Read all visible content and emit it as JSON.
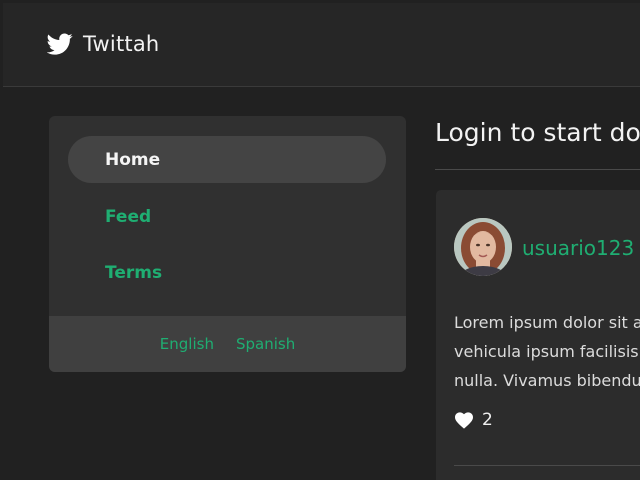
{
  "app": {
    "brand_name": "Twittah",
    "brand_icon": "twitter-bird-icon",
    "accent_color": "#1fae72"
  },
  "sidebar": {
    "items": [
      {
        "label": "Home",
        "active": true
      },
      {
        "label": "Feed",
        "active": false
      },
      {
        "label": "Terms",
        "active": false
      }
    ],
    "languages": [
      {
        "label": "English"
      },
      {
        "label": "Spanish"
      }
    ]
  },
  "main": {
    "title": "Login to start doi",
    "post": {
      "username": "usuario123",
      "text_lines": [
        "Lorem ipsum dolor sit a",
        "vehicula ipsum facilisis",
        "nulla. Vivamus bibendu"
      ],
      "likes": "2",
      "like_icon": "heart-icon"
    }
  }
}
